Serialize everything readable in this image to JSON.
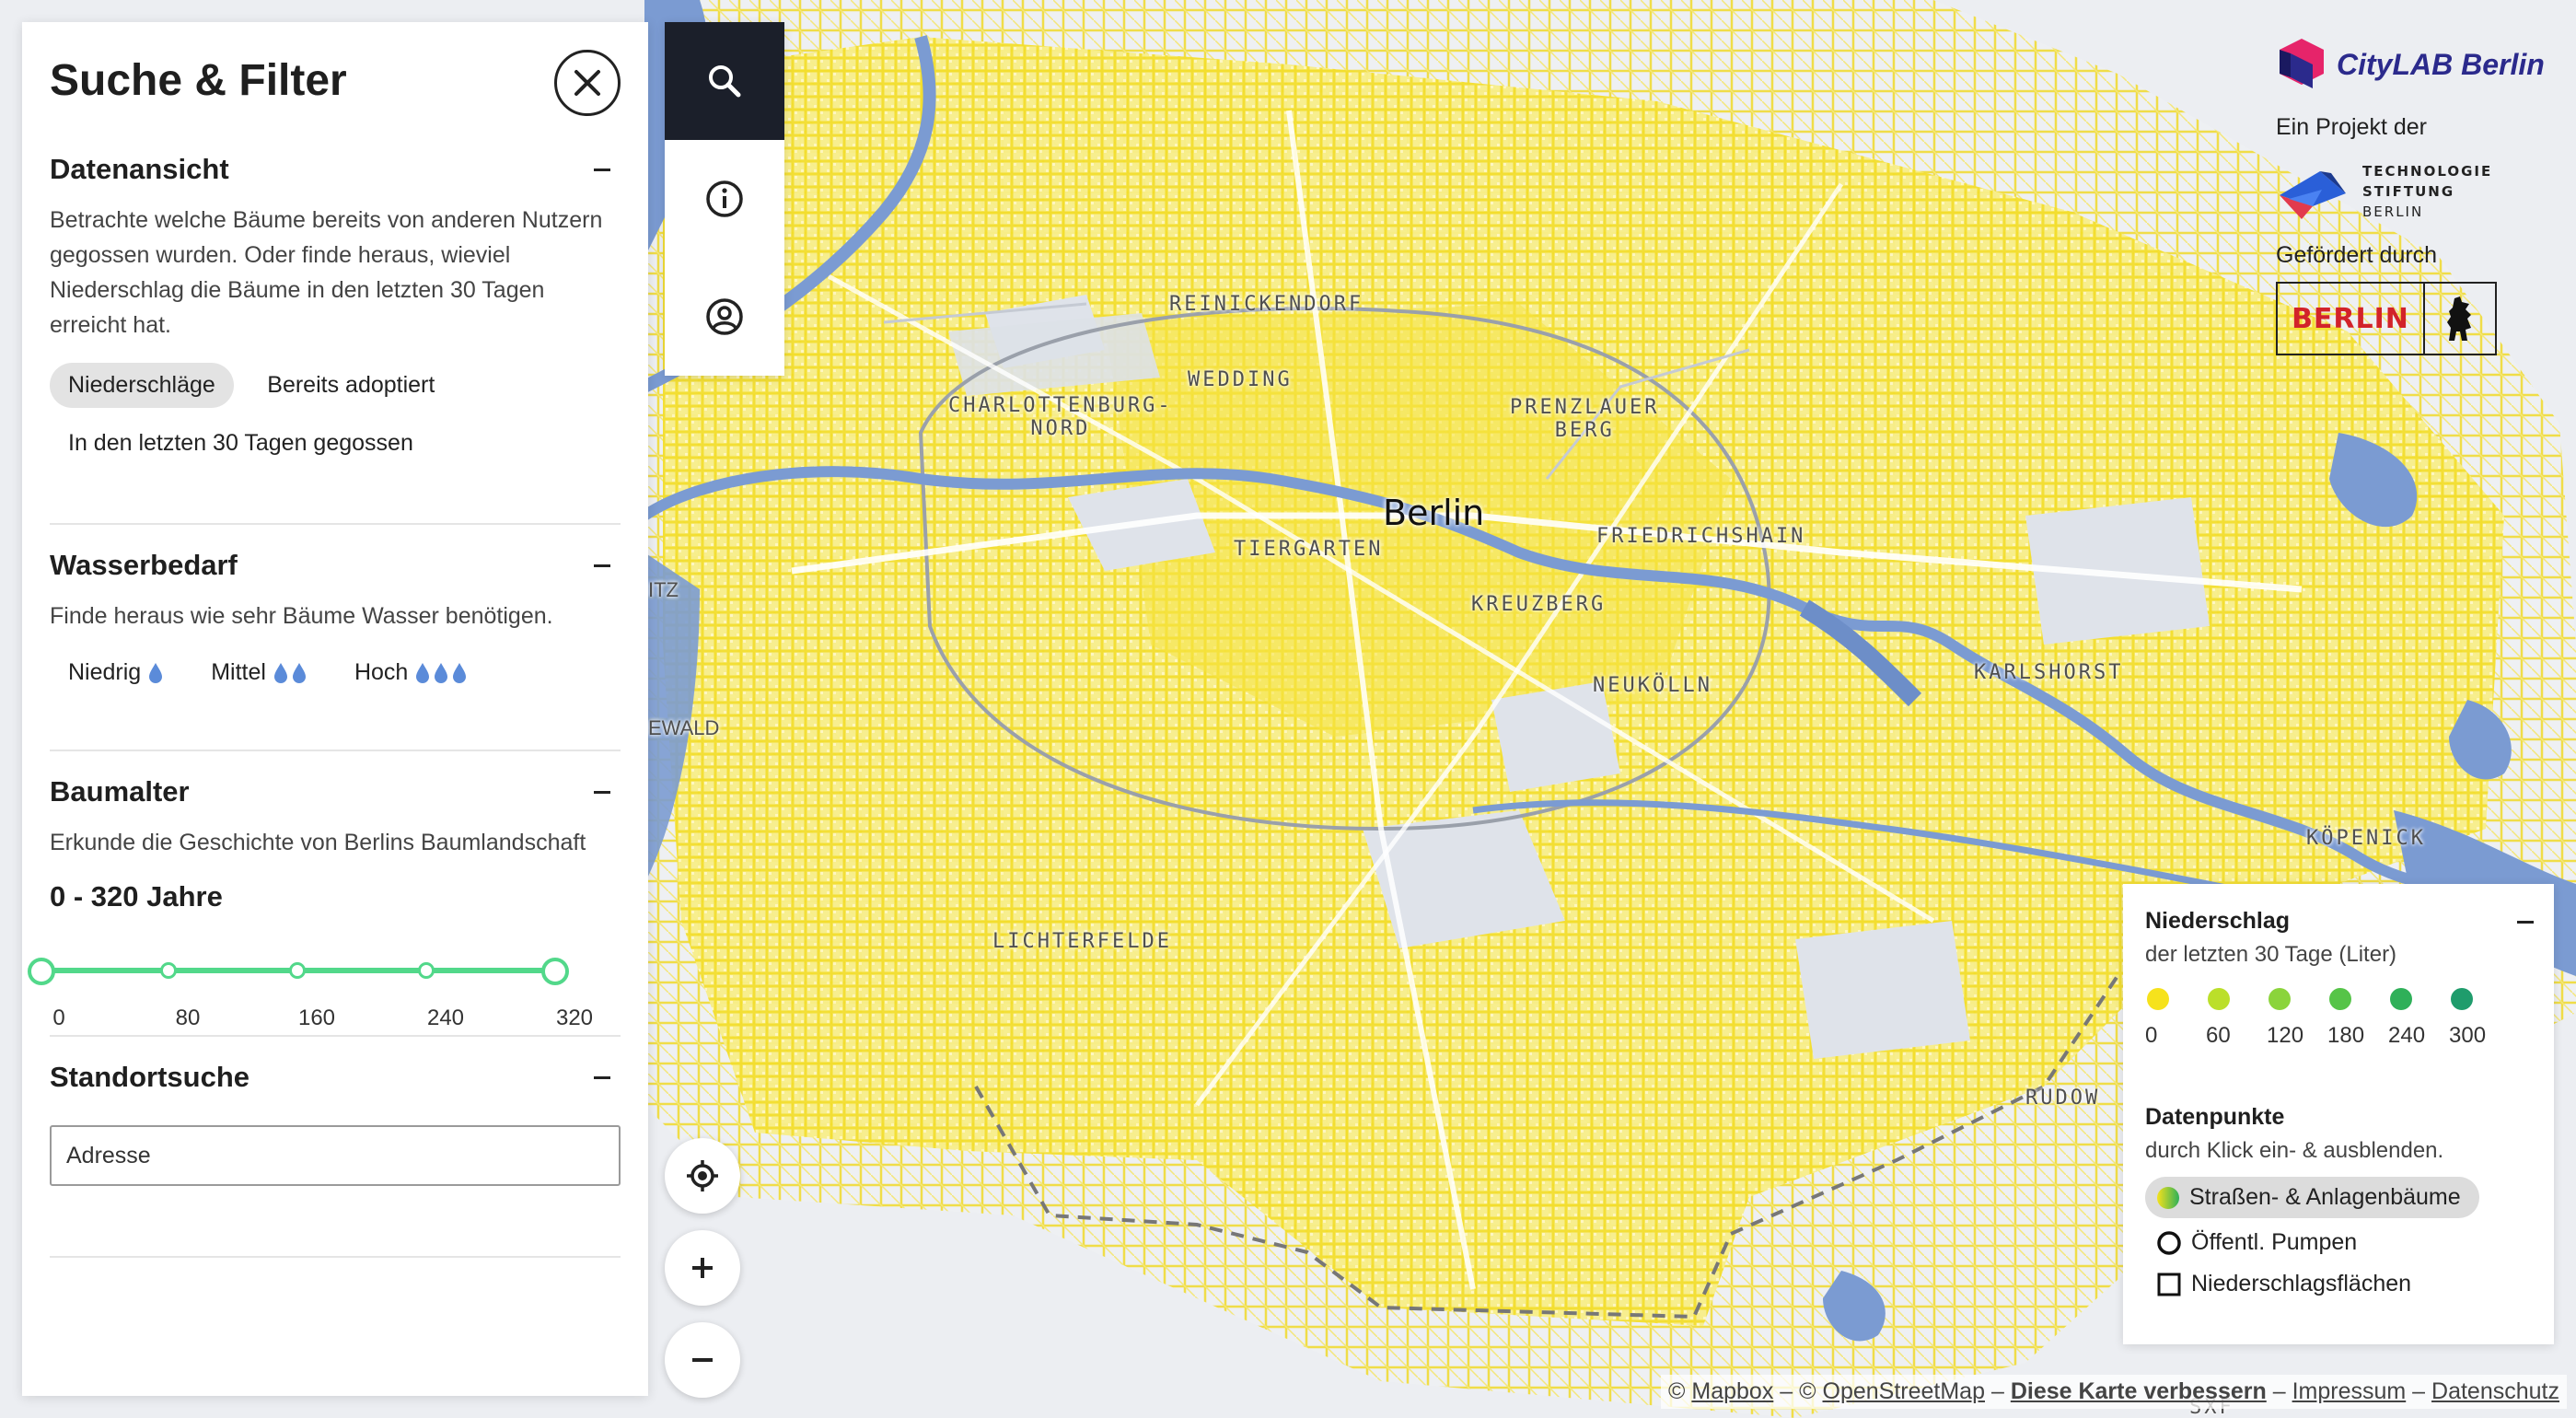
{
  "sidebar": {
    "title": "Suche & Filter",
    "sections": {
      "data_view": {
        "title": "Datenansicht",
        "text": "Betrachte welche Bäume bereits von anderen Nutzern gegossen wurden. Oder finde heraus, wieviel Niederschlag die Bäume in den letzten 30 Tagen erreicht hat.",
        "options": [
          "Niederschläge",
          "Bereits adoptiert",
          "In den letzten 30 Tagen gegossen"
        ],
        "selected": "Niederschläge"
      },
      "water_need": {
        "title": "Wasserbedarf",
        "text": "Finde heraus wie sehr Bäume Wasser benötigen.",
        "options": [
          {
            "label": "Niedrig",
            "drops": 1
          },
          {
            "label": "Mittel",
            "drops": 2
          },
          {
            "label": "Hoch",
            "drops": 3
          }
        ]
      },
      "tree_age": {
        "title": "Baumalter",
        "text": "Erkunde die Geschichte von Berlins Baumlandschaft",
        "range_label": "0 - 320 Jahre",
        "range_min": 0,
        "range_max": 320,
        "ticks": [
          "0",
          "80",
          "160",
          "240",
          "320"
        ]
      },
      "location": {
        "title": "Standortsuche",
        "placeholder": "Adresse"
      }
    }
  },
  "toolbar": [
    "search-icon",
    "info-icon",
    "user-icon"
  ],
  "map": {
    "city": "Berlin",
    "districts": [
      {
        "id": "reinickendorf",
        "label": "REINICKENDORF"
      },
      {
        "id": "wedding",
        "label": "WEDDING"
      },
      {
        "id": "charlottenburg",
        "label": "CHARLOTTENBURG-\nNORD"
      },
      {
        "id": "prenzlauer",
        "label": "PRENZLAUER\nBERG"
      },
      {
        "id": "tiergarten",
        "label": "TIERGARTEN"
      },
      {
        "id": "friedrichshain",
        "label": "FRIEDRICHSHAIN"
      },
      {
        "id": "kreuzberg",
        "label": "KREUZBERG"
      },
      {
        "id": "neukolln",
        "label": "NEUKÖLLN"
      },
      {
        "id": "karlshorst",
        "label": "KARLSHORST"
      },
      {
        "id": "kopenick",
        "label": "KÖPENICK"
      },
      {
        "id": "lichterfelde",
        "label": "LICHTERFELDE"
      },
      {
        "id": "rudow",
        "label": "RUDOW"
      },
      {
        "id": "sxf",
        "label": "SXF"
      }
    ],
    "edge_labels": [
      "itz",
      "ewald"
    ],
    "controls": [
      "locate-icon",
      "zoom-in-icon",
      "zoom-out-icon"
    ],
    "colors": {
      "water": "#7b9bd2",
      "trees": "#f6e452",
      "land": "#eceef2",
      "park": "#dfe3ea"
    }
  },
  "logos": {
    "citylab": "CityLAB Berlin",
    "project_caption": "Ein Projekt der",
    "technologie": [
      "TECHNOLOGIE",
      "STIFTUNG",
      "BERLIN"
    ],
    "funded_caption": "Gefördert durch",
    "berlin": "BERLIN"
  },
  "legend": {
    "precip_title": "Niederschlag",
    "precip_sub": "der letzten 30 Tage (Liter)",
    "scale": [
      {
        "value": "0",
        "color": "#f6e21c"
      },
      {
        "value": "60",
        "color": "#bbdf2a"
      },
      {
        "value": "120",
        "color": "#8bd43b"
      },
      {
        "value": "180",
        "color": "#56c448"
      },
      {
        "value": "240",
        "color": "#2fb059"
      },
      {
        "value": "300",
        "color": "#1f9c6c"
      }
    ],
    "datapoints_title": "Datenpunkte",
    "datapoints_sub": "durch Klick ein- & ausblenden.",
    "datapoints": [
      "Straßen- & Anlagenbäume",
      "Öffentl. Pumpen",
      "Niederschlagsflächen"
    ]
  },
  "attribution": {
    "mapbox": "Mapbox",
    "osm": "OpenStreetMap",
    "improve": "Diese Karte verbessern",
    "impressum": "Impressum",
    "datenschutz": "Datenschutz"
  }
}
